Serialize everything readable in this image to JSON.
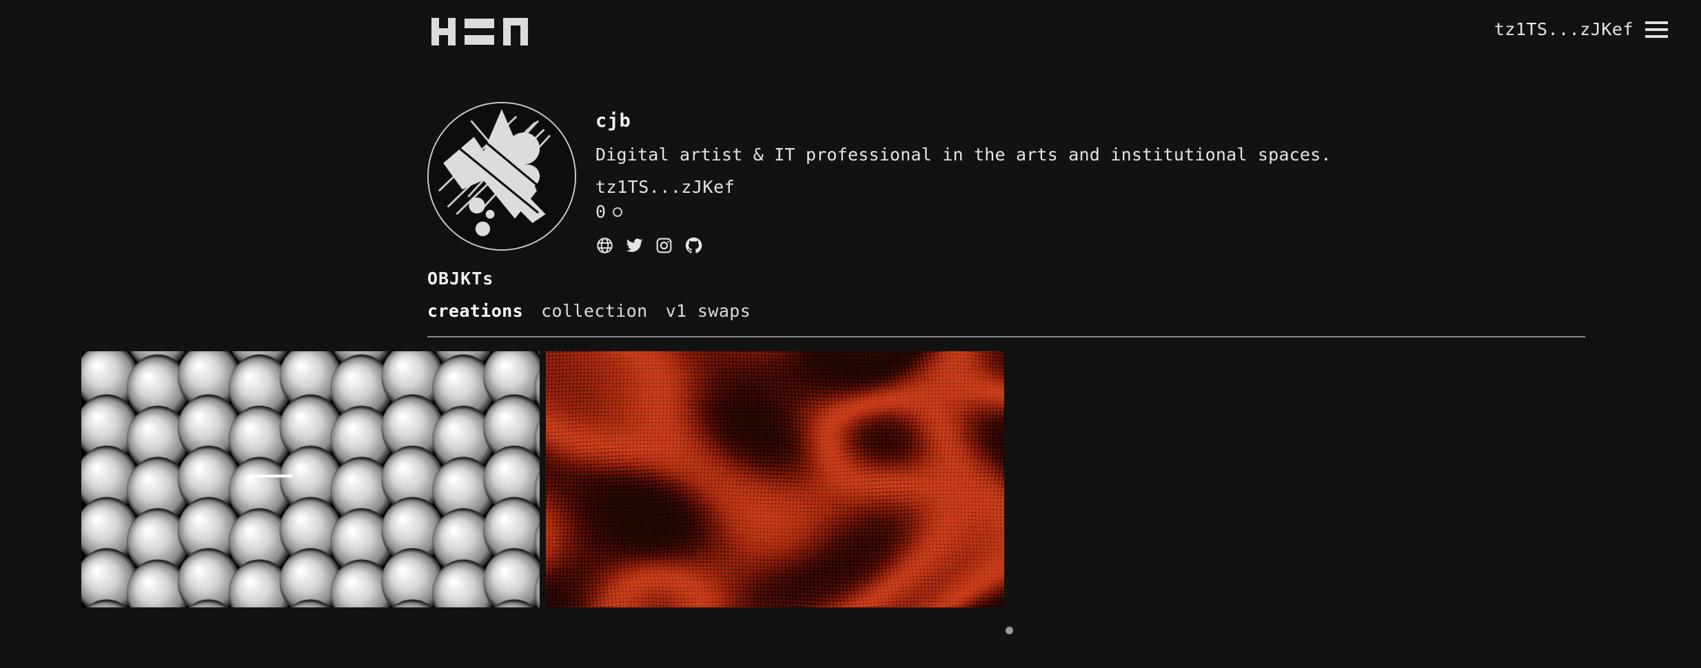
{
  "site": {
    "background_color": "#121212",
    "text_color": "#e8e8e8",
    "logo_name": "hen-logo",
    "logo_text": "H=Π"
  },
  "header": {
    "wallet_address": "tz1TS...zJKef",
    "menu_icon": "hamburger-menu-icon"
  },
  "profile": {
    "avatar_alt": "abstract-geometric-avatar",
    "name": "cjb",
    "bio": "Digital artist & IT professional in the arts and institutional spaces.",
    "address": "tz1TS...zJKef",
    "balance": "0",
    "balance_symbol": "tez-symbol",
    "socials": [
      {
        "name": "website",
        "icon": "globe-icon",
        "label": "Website"
      },
      {
        "name": "twitter",
        "icon": "twitter-icon",
        "label": "Twitter"
      },
      {
        "name": "instagram",
        "icon": "instagram-icon",
        "label": "Instagram"
      },
      {
        "name": "github",
        "icon": "github-icon",
        "label": "GitHub"
      }
    ]
  },
  "objkts": {
    "title": "OBJKTs",
    "tabs": [
      {
        "label": "creations",
        "active": true
      },
      {
        "label": "collection",
        "active": false
      },
      {
        "label": "v1 swaps",
        "active": false
      }
    ]
  },
  "gallery": {
    "items": [
      {
        "name": "artwork-sphere-grid",
        "description": "Grayscale grid of glossy spheres with a white horizontal line marker",
        "style": "sphere-grid",
        "color": "#d8d8d8",
        "background": "#000000"
      },
      {
        "name": "artwork-red-wave-matrix",
        "description": "Red-orange distorted dot matrix wave field",
        "style": "red-wave",
        "color": "#d23a1c",
        "background": "#140604"
      }
    ],
    "loading_indicator": "loading-dot"
  }
}
